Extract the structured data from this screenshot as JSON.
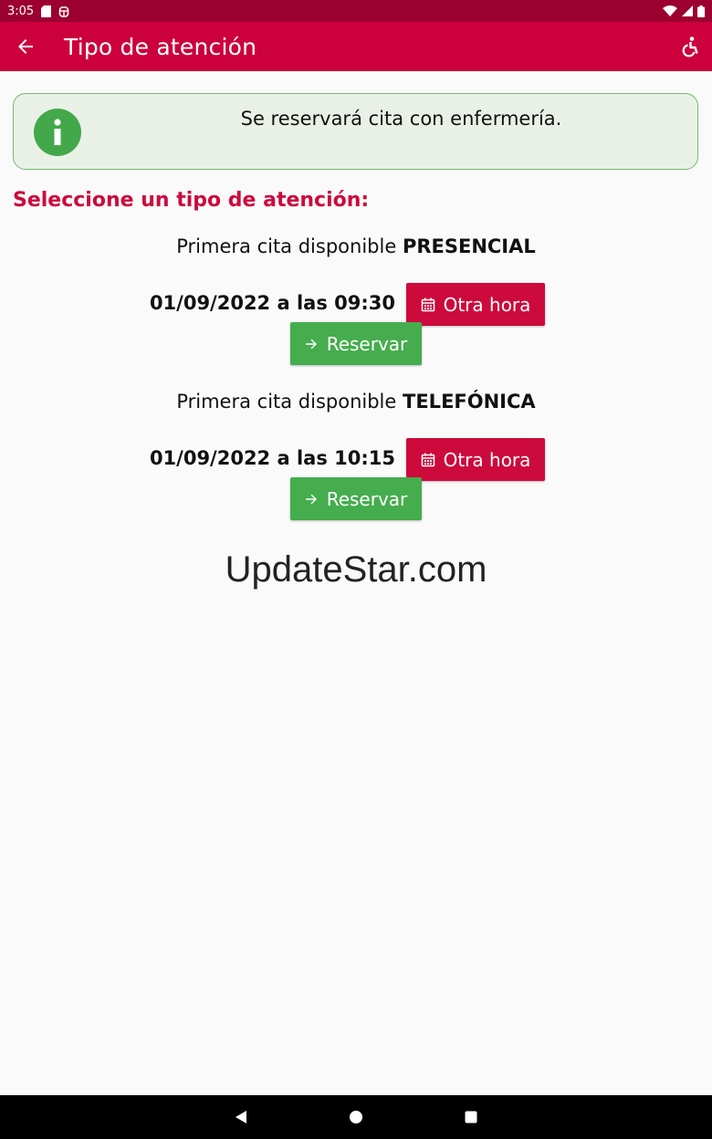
{
  "status": {
    "time": "3:05"
  },
  "header": {
    "title": "Tipo de atención"
  },
  "info": {
    "message": "Se reservará cita con enfermería."
  },
  "section": {
    "title": "Seleccione un tipo de atención:"
  },
  "appointments": [
    {
      "prefix": "Primera cita disponible",
      "type": "PRESENCIAL",
      "datetime": "01/09/2022 a las 09:30",
      "other_label": "Otra hora",
      "reserve_label": "Reservar"
    },
    {
      "prefix": "Primera cita disponible",
      "type": "TELEFÓNICA",
      "datetime": "01/09/2022 a las 10:15",
      "other_label": "Otra hora",
      "reserve_label": "Reservar"
    }
  ],
  "watermark": {
    "text": "UpdateStar.com"
  },
  "colors": {
    "primary": "#cc003d",
    "status_bar": "#9c0030",
    "success": "#45ad4d",
    "info_bg": "#e9f1e6"
  },
  "icons": [
    "back-arrow-icon",
    "accessibility-icon",
    "info-icon",
    "calendar-icon",
    "arrow-right-icon"
  ]
}
